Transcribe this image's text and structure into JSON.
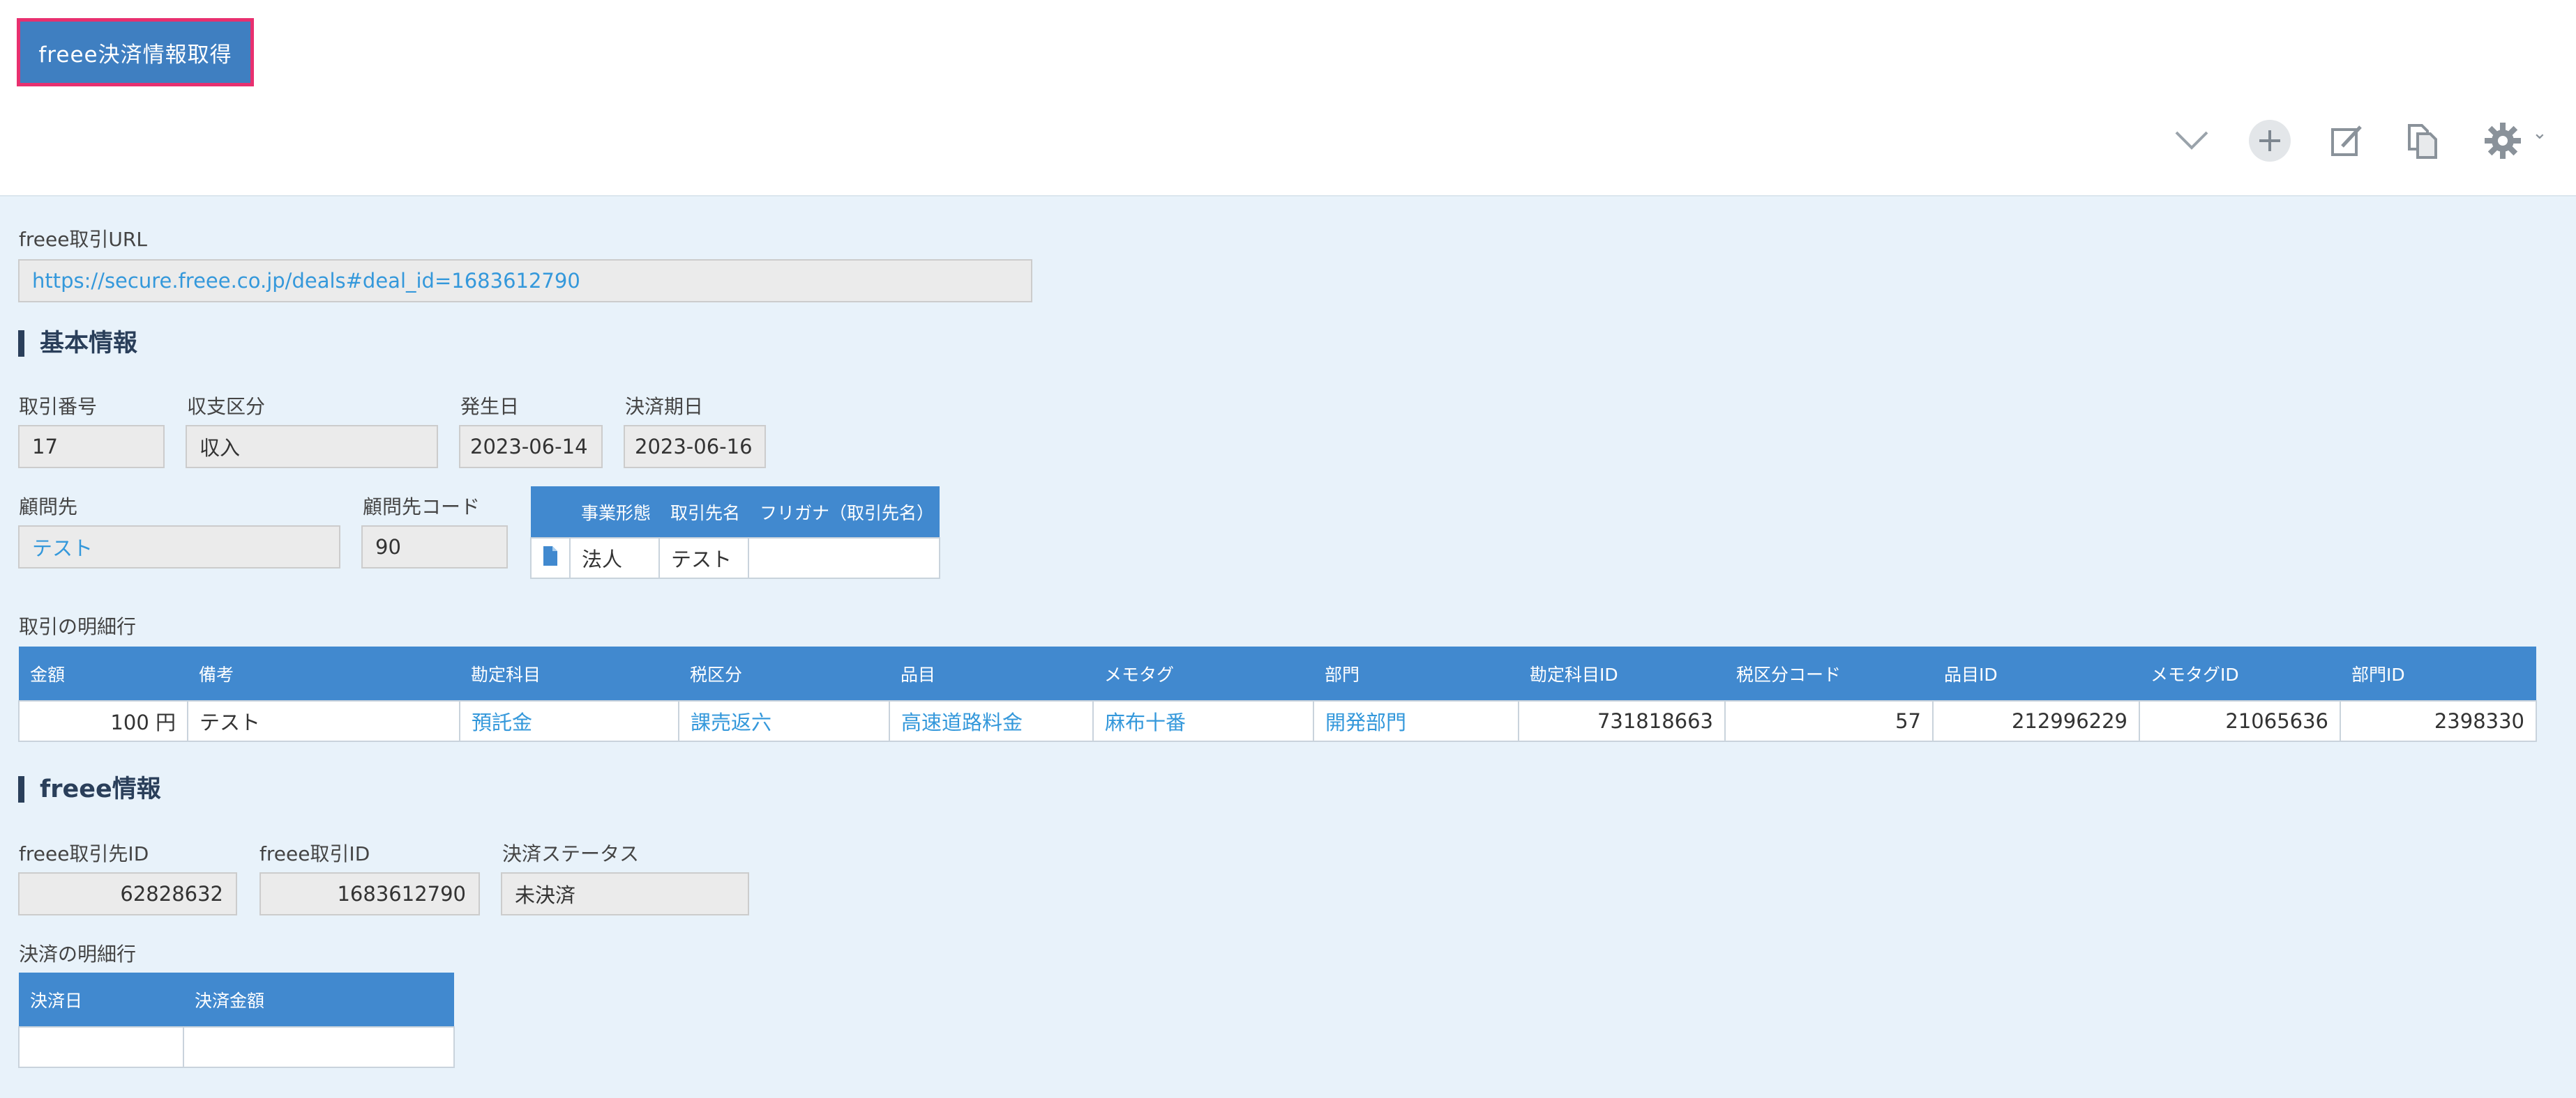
{
  "action_button": "freee決済情報取得",
  "toolbar": {
    "icons": [
      "chevron-down-icon",
      "plus-icon",
      "edit-icon",
      "duplicate-icon",
      "gear-icon"
    ],
    "gear_caret": "⌄"
  },
  "url_field": {
    "label": "freee取引URL",
    "value": "https://secure.freee.co.jp/deals#deal_id=1683612790"
  },
  "basic_info": {
    "title": "基本情報",
    "deal_number": {
      "label": "取引番号",
      "value": "17"
    },
    "income_type": {
      "label": "収支区分",
      "value": "収入"
    },
    "issue_date": {
      "label": "発生日",
      "value": "2023-06-14"
    },
    "due_date": {
      "label": "決済期日",
      "value": "2023-06-16"
    },
    "client": {
      "label": "顧問先",
      "value": "テスト"
    },
    "client_code": {
      "label": "顧問先コード",
      "value": "90"
    },
    "partner_table": {
      "headers": [
        "事業形態",
        "取引先名",
        "フリガナ（取引先名）"
      ],
      "rows": [
        [
          "法人",
          "テスト",
          ""
        ]
      ]
    }
  },
  "detail_lines": {
    "label": "取引の明細行",
    "headers": [
      "金額",
      "備考",
      "勘定科目",
      "税区分",
      "品目",
      "メモタグ",
      "部門",
      "勘定科目ID",
      "税区分コード",
      "品目ID",
      "メモタグID",
      "部門ID"
    ],
    "rows": [
      [
        "100 円",
        "テスト",
        "預託金",
        "課売返六",
        "高速道路料金",
        "麻布十番",
        "開発部門",
        "731818663",
        "57",
        "212996229",
        "21065636",
        "2398330"
      ]
    ]
  },
  "freee_info": {
    "title": "freee情報",
    "partner_id": {
      "label": "freee取引先ID",
      "value": "62828632"
    },
    "deal_id": {
      "label": "freee取引ID",
      "value": "1683612790"
    },
    "payment_status": {
      "label": "決済ステータス",
      "value": "未決済"
    }
  },
  "payment_lines": {
    "label": "決済の明細行",
    "headers": [
      "決済日",
      "決済金額"
    ],
    "rows": [
      [
        "",
        ""
      ]
    ]
  },
  "colors": {
    "header_blue": "#4189cf",
    "button_blue": "#3f7fc1",
    "button_border": "#e8306f",
    "link": "#3498db",
    "page_bg": "#e8f2fa"
  }
}
